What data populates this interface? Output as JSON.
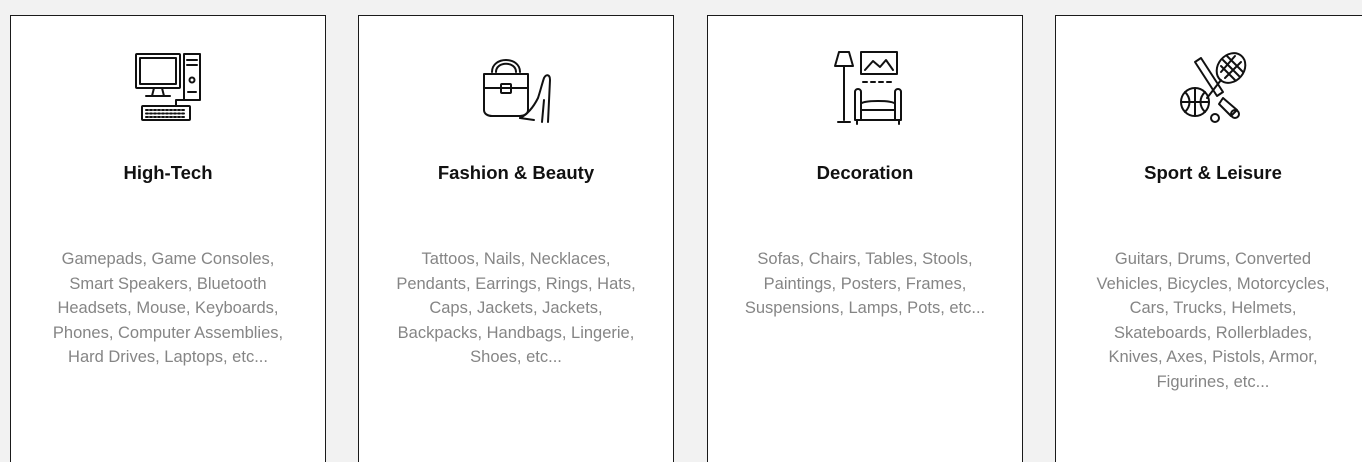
{
  "cards": [
    {
      "icon": "computer-desktop-icon",
      "title": "High-Tech",
      "lines": [
        "Gamepads, Game Consoles,",
        "Smart Speakers, Bluetooth",
        "Headsets, Mouse, Keyboards,",
        "Phones, Computer Assemblies,",
        "Hard Drives, Laptops, etc..."
      ]
    },
    {
      "icon": "handbag-heel-icon",
      "title": "Fashion & Beauty",
      "lines": [
        "Tattoos, Nails, Necklaces,",
        "Pendants, Earrings, Rings, Hats,",
        "Caps, Jackets, Jackets,",
        "Backpacks, Handbags, Lingerie,",
        "Shoes, etc..."
      ]
    },
    {
      "icon": "lamp-sofa-frame-icon",
      "title": "Decoration",
      "lines": [
        "Sofas, Chairs, Tables, Stools,",
        "Paintings, Posters, Frames,",
        "Suspensions, Lamps, Pots, etc..."
      ]
    },
    {
      "icon": "sports-balls-racket-icon",
      "title": "Sport & Leisure",
      "lines": [
        "Guitars, Drums, Converted",
        "Vehicles, Bicycles, Motorcycles,",
        "Cars, Trucks, Helmets,",
        "Skateboards, Rollerblades,",
        "Knives, Axes, Pistols, Armor,",
        "Figurines, etc..."
      ]
    }
  ],
  "colors": {
    "background": "#f2f2f2",
    "card": "#ffffff",
    "border": "#1a1a1a",
    "title": "#111111",
    "description": "#858585"
  }
}
